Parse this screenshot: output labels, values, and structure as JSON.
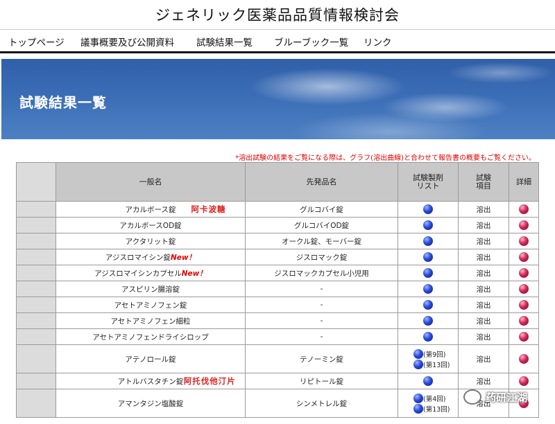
{
  "site_title": "ジェネリック医薬品品質情報検討会",
  "nav": {
    "items": [
      "トップページ",
      "議事概要及び公開資料",
      "試験結果一覧",
      "ブルーブック一覧",
      "リンク"
    ]
  },
  "banner": {
    "title": "試験結果一覧"
  },
  "notice": "*溶出試験の結果をご覧になる際は、グラフ(溶出曲線)と合わせて報告書の概要もご覧ください。",
  "table": {
    "headers": {
      "generic_name": "一般名",
      "brand_name": "先発品名",
      "preparation_list": "試験製剤リスト",
      "test_item": "試験項目",
      "detail": "詳細"
    },
    "rows": [
      {
        "generic": "アカルボース錠",
        "brand": "グルコバイ錠",
        "item": "溶出",
        "annotation": "阿卡波糖"
      },
      {
        "generic": "アカルボースOD錠",
        "brand": "グルコバイOD錠",
        "item": "溶出"
      },
      {
        "generic": "アクタリット錠",
        "brand": "オークル錠、モーバー錠",
        "item": "溶出"
      },
      {
        "generic": "アジスロマイシン錠",
        "new_label": "New！",
        "brand": "ジスロマック錠",
        "item": "溶出"
      },
      {
        "generic": "アジスロマイシンカプセル",
        "new_label": "New！",
        "brand": "ジスロマックカプセル小児用",
        "item": "溶出"
      },
      {
        "generic": "アスピリン腸溶錠",
        "brand": "-",
        "item": "溶出"
      },
      {
        "generic": "アセトアミノフェン錠",
        "brand": "-",
        "item": "溶出"
      },
      {
        "generic": "アセトアミノフェン細粒",
        "brand": "-",
        "item": "溶出"
      },
      {
        "generic": "アセトアミノフェンドライシロップ",
        "brand": "-",
        "item": "溶出"
      },
      {
        "generic": "アテノロール錠",
        "brand": "テノーミン錠",
        "item": "溶出",
        "rounds": [
          "(第9回)",
          "(第13回)"
        ]
      },
      {
        "generic": "アトルバスタチン錠",
        "brand": "リピトール錠",
        "item": "溶出",
        "annotation": "阿托伐他汀片"
      },
      {
        "generic": "アマンタジン塩酸錠",
        "brand": "シンメトレル錠",
        "item": "溶出",
        "rounds": [
          "(第4回)",
          "(第13回)"
        ]
      }
    ]
  },
  "watermark": "药研江湖",
  "icons": {
    "blue": "blue-ball-icon",
    "red": "red-ball-icon"
  },
  "colors": {
    "accent_red": "#e00000",
    "header_gray": "#c8c8c8",
    "banner_blue": "#3b6db6"
  }
}
